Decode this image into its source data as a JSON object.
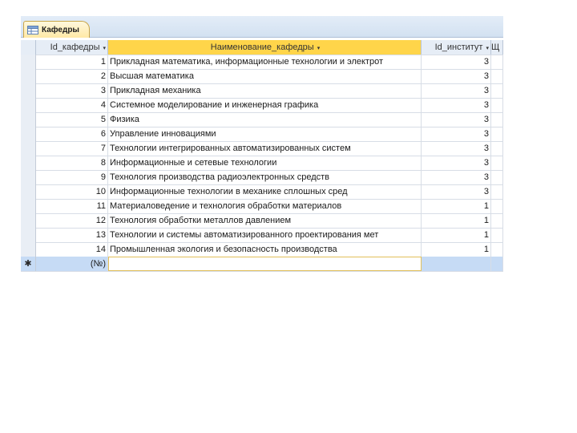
{
  "window": {
    "tab_title": "Кафедры",
    "tab_icon": "table-icon"
  },
  "table": {
    "columns": [
      {
        "label": "Id_кафедры",
        "sort": "▾"
      },
      {
        "label": "Наименование_кафедры",
        "sort": "▾"
      },
      {
        "label": "Id_институт",
        "sort": "▾"
      },
      {
        "label": "Щ"
      }
    ],
    "rows": [
      {
        "id": "1",
        "name": "Прикладная математика, информационные технологии и электрот",
        "inst": "3"
      },
      {
        "id": "2",
        "name": "Высшая математика",
        "inst": "3"
      },
      {
        "id": "3",
        "name": "Прикладная механика",
        "inst": "3"
      },
      {
        "id": "4",
        "name": "Системное моделирование и инженерная графика",
        "inst": "3"
      },
      {
        "id": "5",
        "name": "Физика",
        "inst": "3"
      },
      {
        "id": "6",
        "name": "Управление инновациями",
        "inst": "3"
      },
      {
        "id": "7",
        "name": "Технологии интегрированных автоматизированных систем",
        "inst": "3"
      },
      {
        "id": "8",
        "name": "Информационные и сетевые технологии",
        "inst": "3"
      },
      {
        "id": "9",
        "name": "Технология производства радиоэлектронных средств",
        "inst": "3"
      },
      {
        "id": "10",
        "name": "Информационные технологии в механике сплошных сред",
        "inst": "3"
      },
      {
        "id": "11",
        "name": "Материаловедение и технология обработки материалов",
        "inst": "1"
      },
      {
        "id": "12",
        "name": "Технология обработки металлов давлением",
        "inst": "1"
      },
      {
        "id": "13",
        "name": "Технологии и системы автоматизированного проектирования мет",
        "inst": "1"
      },
      {
        "id": "14",
        "name": "Промышленная экология и безопасность производства",
        "inst": "1"
      }
    ],
    "new_row": {
      "marker": "✱",
      "id": "(№)"
    }
  },
  "colors": {
    "header_highlight": "#ffd54a",
    "new_row_bg": "#c6dbf5",
    "tab_bg": "#ffe9a6"
  }
}
